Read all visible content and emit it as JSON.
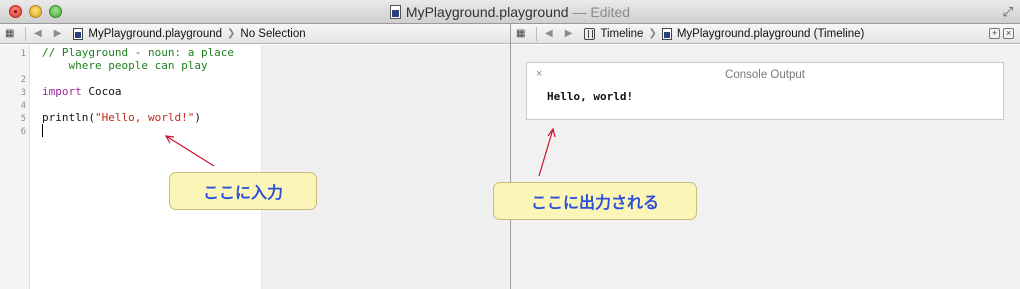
{
  "window": {
    "title": "MyPlayground.playground",
    "edited": "— Edited"
  },
  "editor_jumpbar": {
    "file": "MyPlayground.playground",
    "selection": "No Selection"
  },
  "timeline_jumpbar": {
    "section": "Timeline",
    "file": "MyPlayground.playground (Timeline)"
  },
  "editor": {
    "line_numbers": [
      "1",
      "2",
      "3",
      "4",
      "5",
      "6"
    ],
    "lines": {
      "comment_1": "// Playground - noun: a place",
      "comment_2": "    where people can play",
      "import_keyword": "import",
      "import_module": " Cocoa",
      "call": "println(",
      "string": "\"Hello, world!\"",
      "close_paren": ")"
    }
  },
  "console": {
    "close_symbol": "×",
    "title": "Console Output",
    "output": "Hello, world!"
  },
  "annotations": {
    "input_label": "ここに入力",
    "output_label": "ここに出力される"
  },
  "colors": {
    "comment": "#1f7f1f",
    "keyword": "#a1239b",
    "string": "#c0291c",
    "annotation_text": "#2b4fd9",
    "annotation_fill": "#fcf5b8",
    "annotation_arrow": "#c8102e"
  },
  "icons": [
    "grid-icon",
    "back-arrow-icon",
    "forward-arrow-icon",
    "playground-file-icon",
    "timeline-icon",
    "add-icon",
    "close-icon",
    "fullscreen-icon"
  ]
}
